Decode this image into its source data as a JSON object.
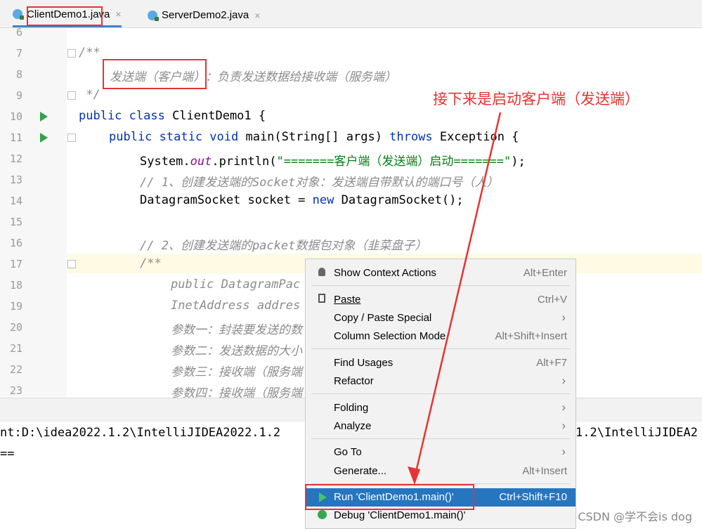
{
  "tabs": [
    {
      "label": "ClientDemo1.java",
      "close": "×"
    },
    {
      "label": "ServerDemo2.java",
      "close": "×"
    }
  ],
  "editor": {
    "lines": [
      {
        "n": "6"
      },
      {
        "n": "7"
      },
      {
        "n": "8"
      },
      {
        "n": "9"
      },
      {
        "n": "10"
      },
      {
        "n": "11"
      },
      {
        "n": "12"
      },
      {
        "n": "13"
      },
      {
        "n": "14"
      },
      {
        "n": "15"
      },
      {
        "n": "16"
      },
      {
        "n": "17"
      },
      {
        "n": "18"
      },
      {
        "n": "19"
      },
      {
        "n": "20"
      },
      {
        "n": "21"
      },
      {
        "n": "22"
      },
      {
        "n": "23"
      }
    ],
    "code": {
      "l7": "/**",
      "l8_a": "发送端（客户端）",
      "l8_b": "：负责发送数据给接收端（服务端）",
      "l9": " */",
      "l10_kw": "public class ",
      "l10_rest": "ClientDemo1 {",
      "l11_kw": "public static void ",
      "l11_rest": "main(String[] args) ",
      "l11_throws": "throws",
      "l11_end": " Exception {",
      "l12_a": "System.",
      "l12_fld": "out",
      "l12_b": ".println(",
      "l12_str": "\"=======客户端（发送端）启动=======\"",
      "l12_c": ");",
      "l13": "// 1、创建发送端的Socket对象：发送端自带默认的端口号（人）",
      "l14_a": "DatagramSocket socket = ",
      "l14_kw": "new",
      "l14_b": " DatagramSocket();",
      "l16": "// 2、创建发送端的packet数据包对象（韭菜盘子）",
      "l17": "/**",
      "l18": "public DatagramPac",
      "l19": "InetAddress addres",
      "l20": "参数一：封装要发送的数",
      "l21": "参数二：发送数据的大小",
      "l22": "参数三：接收端（服务端",
      "l23": "参数四：接收端（服务端"
    }
  },
  "console": {
    "line1_left": "nt:D:\\idea2022.1.2\\IntelliJIDEA2022.1.2",
    "line1_right": "1.2\\IntelliJIDEA2",
    "line2": "=="
  },
  "context_menu": {
    "items": [
      {
        "label": "Show Context Actions",
        "shortcut": "Alt+Enter"
      },
      {
        "label": "Paste",
        "shortcut": "Ctrl+V"
      },
      {
        "label": "Copy / Paste Special",
        "shortcut": ""
      },
      {
        "label": "Column Selection Mode",
        "shortcut": "Alt+Shift+Insert"
      },
      {
        "label": "Find Usages",
        "shortcut": "Alt+F7"
      },
      {
        "label": "Refactor",
        "shortcut": ""
      },
      {
        "label": "Folding",
        "shortcut": ""
      },
      {
        "label": "Analyze",
        "shortcut": ""
      },
      {
        "label": "Go To",
        "shortcut": ""
      },
      {
        "label": "Generate...",
        "shortcut": "Alt+Insert"
      },
      {
        "label": "Run 'ClientDemo1.main()'",
        "shortcut": "Ctrl+Shift+F10"
      },
      {
        "label": "Debug 'ClientDemo1.main()'",
        "shortcut": ""
      }
    ]
  },
  "annotation": {
    "text": "接下来是启动客户端（发送端）",
    "color": "#e83333"
  },
  "watermark": "CSDN @学不会is dog"
}
